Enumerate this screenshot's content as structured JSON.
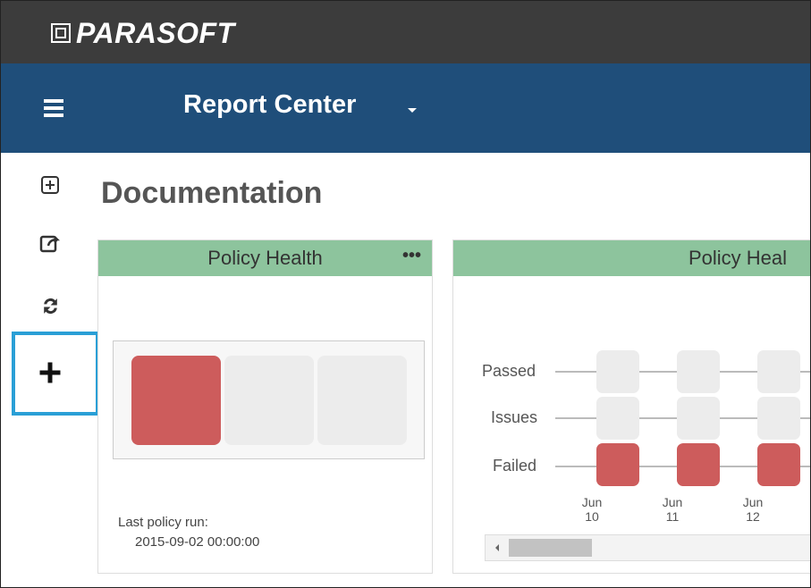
{
  "brand": {
    "logo_text": "PARASOFT"
  },
  "nav": {
    "title": "Report Center"
  },
  "page": {
    "title": "Documentation"
  },
  "toolbar": {
    "icons": [
      "expand-icon",
      "share-icon",
      "refresh-icon",
      "add-icon"
    ]
  },
  "widgets": [
    {
      "title": "Policy Health",
      "menu": "•••",
      "tiles": [
        {
          "status": "failed"
        },
        {
          "status": "empty"
        },
        {
          "status": "empty"
        }
      ],
      "last_run_label": "Last policy run:",
      "last_run_value": "2015-09-02 00:00:00"
    },
    {
      "title": "Policy Heal",
      "rows": [
        "Passed",
        "Issues",
        "Failed"
      ],
      "columns": [
        {
          "date_month": "Jun",
          "date_day": "10",
          "status": "failed"
        },
        {
          "date_month": "Jun",
          "date_day": "11",
          "status": "failed"
        },
        {
          "date_month": "Jun",
          "date_day": "12",
          "status": "failed"
        }
      ]
    }
  ],
  "colors": {
    "topbar": "#3c3c3c",
    "navbar": "#1f4e7a",
    "widget_header": "#8dc49d",
    "failed": "#cd5c5c",
    "highlight": "#2a9fd6"
  }
}
